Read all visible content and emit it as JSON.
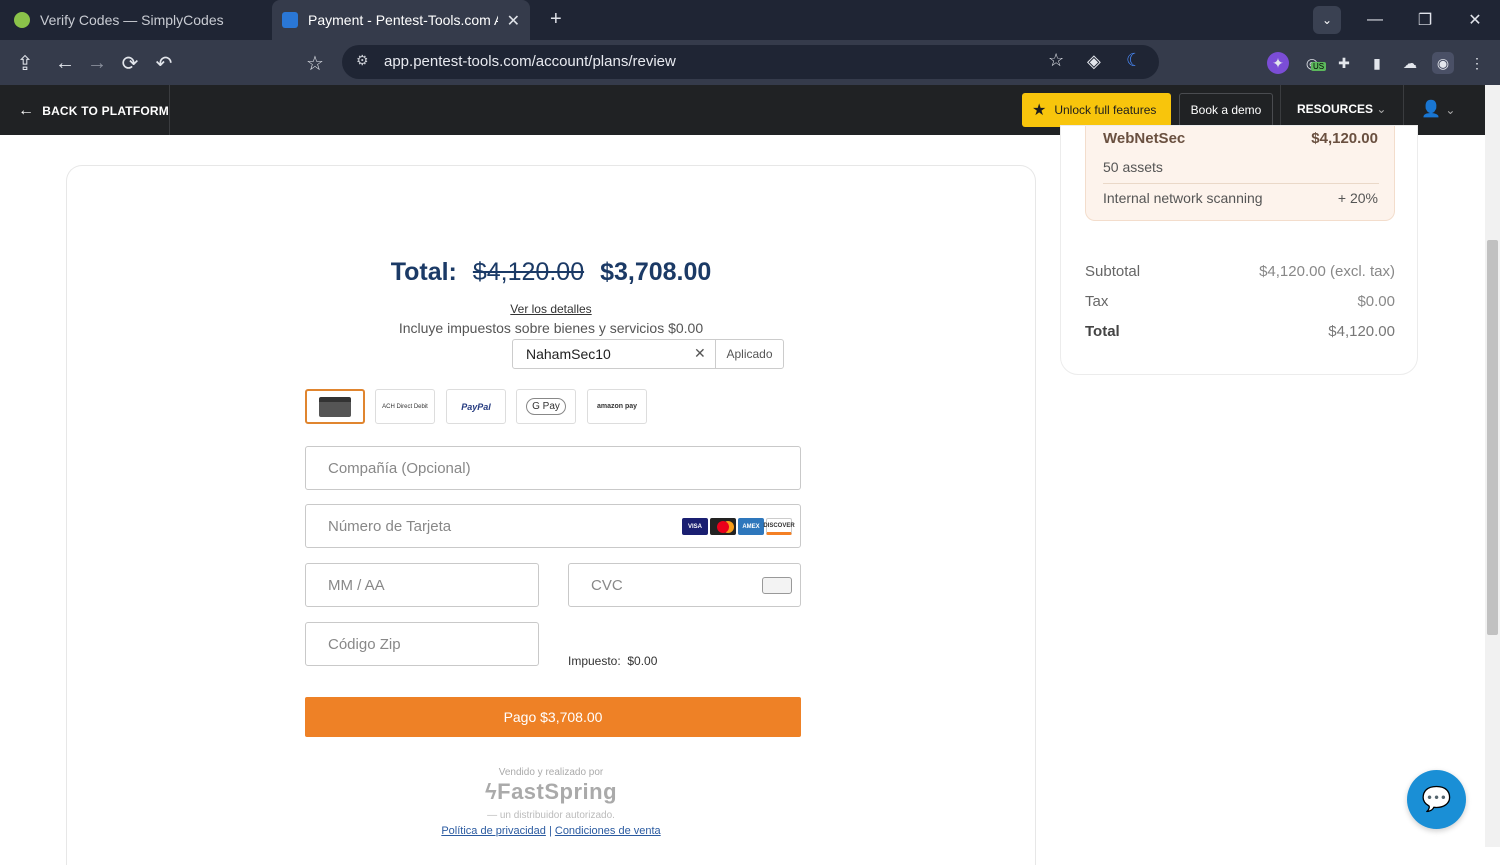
{
  "browser": {
    "tabs": [
      {
        "title": "Verify Codes — SimplyCodes",
        "icon": "simplycodes-icon"
      },
      {
        "title": "Payment - Pentest-Tools.com App",
        "icon": "pentest-tools-icon"
      }
    ],
    "new_tab": "+",
    "url": "app.pentest-tools.com/account/plans/review",
    "ext_badge": "US"
  },
  "appbar": {
    "back_label": "BACK TO PLATFORM",
    "unlock_label": "Unlock full features",
    "demo_label": "Book a demo",
    "resources_label": "RESOURCES"
  },
  "checkout": {
    "total_label": "Total:",
    "old_total": "$4,120.00",
    "new_total": "$3,708.00",
    "details_link": "Ver los detalles",
    "tax_note": "Incluye impuestos sobre bienes y servicios $0.00",
    "coupon_code": "NahamSec10",
    "coupon_status": "Aplicado",
    "payment_methods": [
      "Card",
      "ACH Direct Debit",
      "PayPal",
      "G Pay",
      "amazon pay"
    ],
    "company_placeholder": "Compañía (Opcional)",
    "card_placeholder": "Número de Tarjeta",
    "expiry_placeholder": "MM / AA",
    "cvc_placeholder": "CVC",
    "zip_placeholder": "Código Zip",
    "impuesto_label": "Impuesto:",
    "impuesto_value": "$0.00",
    "pay_button": "Pago $3,708.00",
    "sold_by": "Vendido y realizado por",
    "brand": "FastSpring",
    "distributor": "— un distribuidor autorizado.",
    "privacy_link": "Política de privacidad",
    "terms_link": "Condiciones de venta",
    "card_brands": [
      "VISA",
      "MC",
      "AMEX",
      "DISCOVER"
    ]
  },
  "summary": {
    "plan_name": "WebNetSec",
    "plan_price": "$4,120.00",
    "assets": "50 assets",
    "feature": "Internal network scanning",
    "feature_pct": "+ 20%",
    "subtotal_label": "Subtotal",
    "subtotal_value": "$4,120.00 (excl. tax)",
    "tax_label": "Tax",
    "tax_value": "$0.00",
    "total_label": "Total",
    "total_value": "$4,120.00"
  },
  "colors": {
    "accent": "#ee8126",
    "unlock": "#f8c50c",
    "navy": "#1b3a66",
    "chat": "#1a8fd6"
  }
}
